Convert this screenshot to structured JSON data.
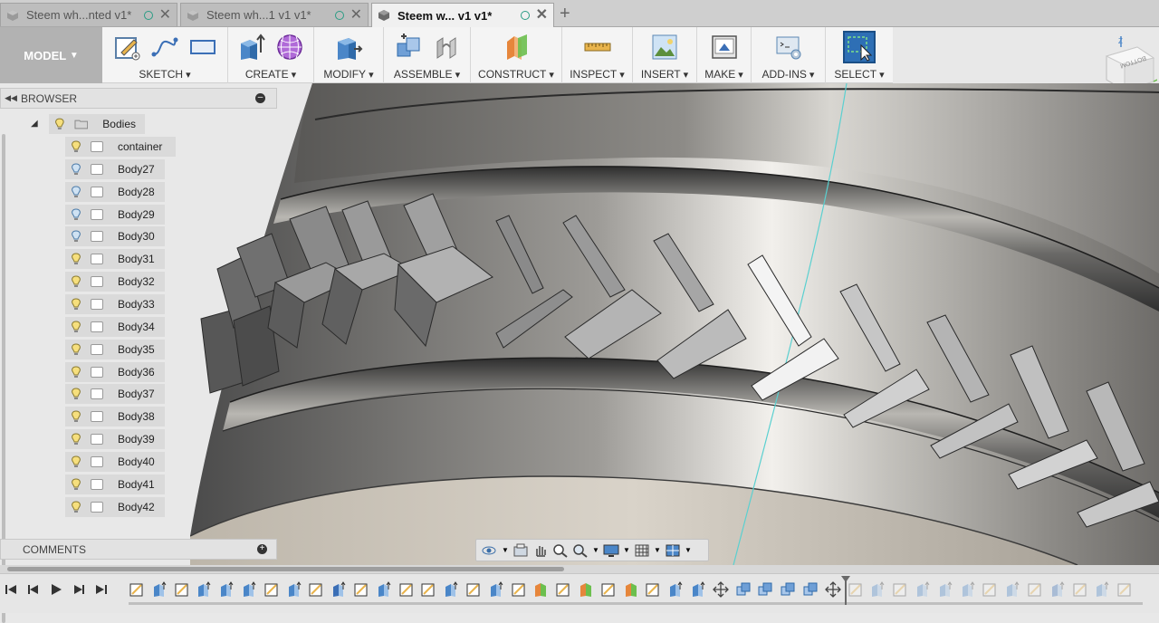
{
  "tabs": [
    {
      "label": "Steem wh...nted v1*"
    },
    {
      "label": "Steem wh...1 v1 v1*"
    },
    {
      "label": "Steem w... v1 v1*"
    }
  ],
  "toolbar": {
    "workspace": "MODEL",
    "groups": [
      {
        "label": "SKETCH"
      },
      {
        "label": "CREATE"
      },
      {
        "label": "MODIFY"
      },
      {
        "label": "ASSEMBLE"
      },
      {
        "label": "CONSTRUCT"
      },
      {
        "label": "INSPECT"
      },
      {
        "label": "INSERT"
      },
      {
        "label": "MAKE"
      },
      {
        "label": "ADD-INS"
      },
      {
        "label": "SELECT"
      }
    ]
  },
  "viewcube": {
    "face_label": "BOTTOM"
  },
  "browser": {
    "title": "BROWSER",
    "folder": "Bodies",
    "items": [
      {
        "label": "container",
        "visible": false
      },
      {
        "label": "Body27",
        "visible": true
      },
      {
        "label": "Body28",
        "visible": true
      },
      {
        "label": "Body29",
        "visible": true
      },
      {
        "label": "Body30",
        "visible": true
      },
      {
        "label": "Body31",
        "visible": false
      },
      {
        "label": "Body32",
        "visible": false
      },
      {
        "label": "Body33",
        "visible": false
      },
      {
        "label": "Body34",
        "visible": false
      },
      {
        "label": "Body35",
        "visible": false
      },
      {
        "label": "Body36",
        "visible": false
      },
      {
        "label": "Body37",
        "visible": false
      },
      {
        "label": "Body38",
        "visible": false
      },
      {
        "label": "Body39",
        "visible": false
      },
      {
        "label": "Body40",
        "visible": false
      },
      {
        "label": "Body41",
        "visible": false
      },
      {
        "label": "Body42",
        "visible": false
      }
    ]
  },
  "comments": {
    "title": "COMMENTS"
  },
  "colors": {
    "accent": "#2e6fb5",
    "select_green": "#2a9c84"
  }
}
